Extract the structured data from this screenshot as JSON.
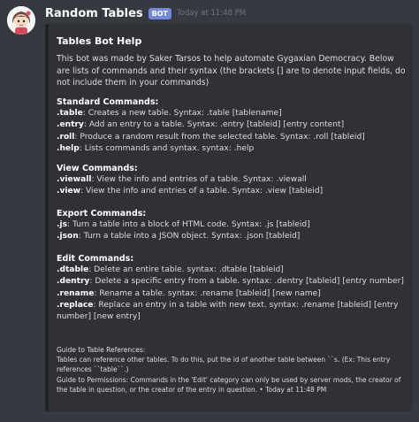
{
  "message": {
    "username": "Random Tables",
    "bot_tag": "BOT",
    "timestamp": "Today at 11:48 PM"
  },
  "embed": {
    "title": "Tables Bot Help",
    "description": "This bot was made by Saker Tarsos to help automate Gygaxian Democracy. Below are lists of commands and their syntax (the brackets [] are to denote input fields, do not include them in your commands)",
    "sections": {
      "standard": {
        "name": "Standard Commands:",
        "items": [
          {
            "cmd": ".table",
            "text": ": Creates a new table. Syntax: .table [tablename]"
          },
          {
            "cmd": ".entry",
            "text": ": Add an entry to a table. Syntax: .entry [tableid] [entry content]"
          },
          {
            "cmd": ".roll",
            "text": ": Produce a random result from the selected table. Syntax: .roll [tableid]"
          },
          {
            "cmd": ".help",
            "text": ": Lists commands and syntax. syntax: .help"
          }
        ]
      },
      "view": {
        "name": "View Commands:",
        "items": [
          {
            "cmd": ".viewall",
            "text": ": View the info and entries of a table. Syntax: .viewall"
          },
          {
            "cmd": ".view",
            "text": ": View the info and entries of a table. Syntax: .view [tableid]"
          }
        ]
      },
      "export": {
        "name": "Export Commands:",
        "items": [
          {
            "cmd": ".js",
            "text": ": Turn a table into a block of HTML code. Syntax: .js [tableid]"
          },
          {
            "cmd": ".json",
            "text": ": Turn a table into a JSON object. Syntax: .json [tableid]"
          }
        ]
      },
      "edit": {
        "name": "Edit Commands:",
        "items": [
          {
            "cmd": ".dtable",
            "text": ": Delete an entire table. syntax: .dtable [tableid]"
          },
          {
            "cmd": ".dentry",
            "text": ": Delete a specific entry from a table. syntax: .dentry [tableid] [entry number]"
          },
          {
            "cmd": ".rename",
            "text": ": Rename a table. syntax: .rename [tableid] [new name]"
          },
          {
            "cmd": ".replace",
            "text": ": Replace an entry in a table with new text. syntax: .rename [tableid] [entry number] [new entry]"
          }
        ]
      }
    },
    "footer": {
      "line1": "Guide to Table References:",
      "line2": "Tables can reference other tables. To do this, put the id of another table between ``s. (Ex: This entry references ``table``.)",
      "line3": "Guide to Permissions: Commands in the 'Edit' category can only be used by server mods, the creator of the table in question, or the creator of the entry in question.",
      "separator": " • ",
      "timestamp": "Today at 11:48 PM"
    }
  },
  "colors": {
    "background": "#36393f",
    "embed_bg": "#2f3136",
    "bot_tag": "#7289da"
  },
  "icons": {
    "avatar": "cartoon-girl-avatar"
  }
}
